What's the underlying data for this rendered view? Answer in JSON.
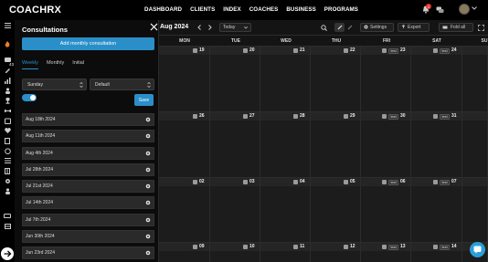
{
  "app": {
    "logo": "COACHRX"
  },
  "nav": [
    {
      "label": "DASHBOARD"
    },
    {
      "label": "CLIENTS"
    },
    {
      "label": "INDEX"
    },
    {
      "label": "COACHES"
    },
    {
      "label": "BUSINESS"
    },
    {
      "label": "PROGRAMS"
    }
  ],
  "topbar": {
    "notification_count": "1"
  },
  "rail": {
    "count_label": "43"
  },
  "panel": {
    "title": "Consultations",
    "add_button": "Add monthly consultation",
    "tabs": [
      "Weekly",
      "Monthly",
      "Initial"
    ],
    "active_tab": "Weekly",
    "day_select": "Sunday",
    "type_select": "Default",
    "save_button": "Save",
    "items": [
      "Aug 18th 2024",
      "Aug 11th 2024",
      "Aug 4th 2024",
      "Jul 28th 2024",
      "Jul 21st 2024",
      "Jul 14th 2024",
      "Jul 7th 2024",
      "Jun 30th 2024",
      "Jun 23rd 2024"
    ]
  },
  "calendar": {
    "month_label": "Aug 2024",
    "today_button": "Today",
    "settings_button": "Settings",
    "export_button": "Export",
    "fold_button": "Fold all",
    "days": [
      "MON",
      "TUE",
      "WED",
      "THU",
      "FRI",
      "SAT",
      "SU"
    ],
    "weeks": [
      {
        "dates": [
          "19",
          "20",
          "21",
          "22",
          "23",
          "24",
          ""
        ],
        "tags": {
          "4": "test",
          "5": "test"
        }
      },
      {
        "dates": [
          "26",
          "27",
          "28",
          "29",
          "30",
          "31",
          ""
        ],
        "tags": {
          "4": "test",
          "5": "test"
        }
      },
      {
        "dates": [
          "02",
          "03",
          "04",
          "05",
          "06",
          "07",
          ""
        ],
        "tags": {
          "4": "test",
          "5": "test"
        }
      },
      {
        "dates": [
          "09",
          "10",
          "11",
          "12",
          "13",
          "14",
          ""
        ],
        "tags": {
          "4": "test",
          "5": "test"
        }
      }
    ]
  },
  "colors": {
    "accent": "#2a8fc9",
    "background": "#1a1a1a",
    "topbar": "#000000"
  }
}
